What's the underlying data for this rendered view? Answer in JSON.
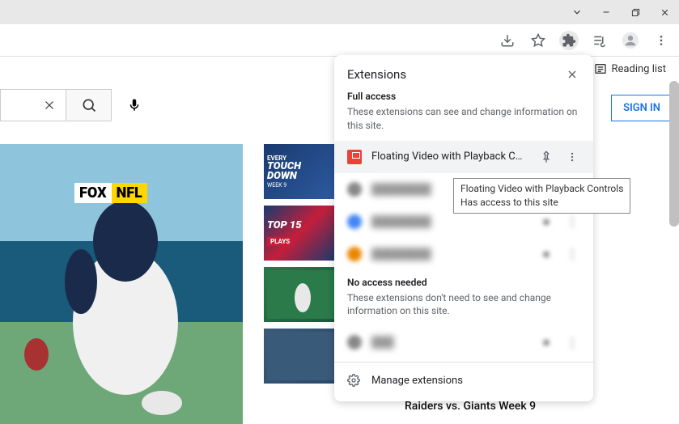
{
  "toolbar": {
    "reading_list_label": "Reading list"
  },
  "signin": {
    "label": "SIGN IN"
  },
  "extensions_popup": {
    "title": "Extensions",
    "full_access_title": "Full access",
    "full_access_desc": "These extensions can see and change information on this site.",
    "no_access_title": "No access needed",
    "no_access_desc": "These extensions don't need to see and change information on this site.",
    "items": [
      {
        "name": "Floating Video with Playback C…"
      }
    ],
    "manage_label": "Manage extensions"
  },
  "tooltip": {
    "line1": "Floating Video with Playback Controls",
    "line2": "Has access to this site"
  },
  "main_video": {
    "logo_left": "FOX",
    "logo_right": "NFL"
  },
  "thumbs": [
    {
      "line1": "EVERY",
      "line2a": "TOUCH",
      "line2b": "DOWN",
      "week": "WEEK 9"
    },
    {
      "line1": "TOP 15",
      "line2": "PLAYS"
    }
  ],
  "side_video": {
    "title": "Raiders vs. Giants Week 9"
  }
}
